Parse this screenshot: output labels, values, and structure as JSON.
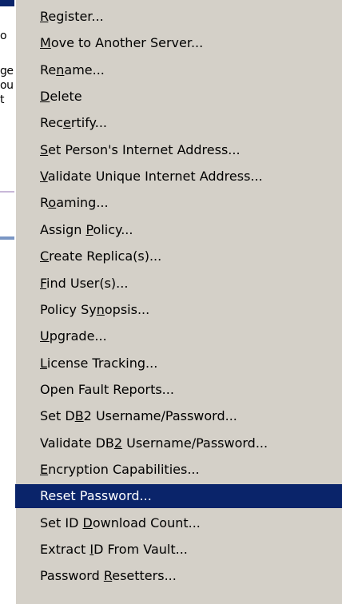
{
  "background_window": {
    "text_lines": [
      "o",
      "ge",
      "ou",
      "t"
    ]
  },
  "menu": {
    "selected_index": 20,
    "colors": {
      "face": "#d4d0c8",
      "highlight": "#0a246a",
      "highlight_text": "#ffffff"
    },
    "items": [
      {
        "label": "Register...",
        "mnemonic_index": 0
      },
      {
        "label": "Move to Another Server...",
        "mnemonic_index": 0
      },
      {
        "label": "Rename...",
        "mnemonic_index": 2
      },
      {
        "label": "Delete",
        "mnemonic_index": 0
      },
      {
        "label": "Recertify...",
        "mnemonic_index": 3
      },
      {
        "label": "Set Person's Internet Address...",
        "mnemonic_index": 0
      },
      {
        "label": "Validate Unique Internet Address...",
        "mnemonic_index": 0
      },
      {
        "label": "Roaming...",
        "mnemonic_index": 1
      },
      {
        "label": "Assign Policy...",
        "mnemonic_index": 7
      },
      {
        "label": "Create Replica(s)...",
        "mnemonic_index": 0
      },
      {
        "label": "Find User(s)...",
        "mnemonic_index": 0
      },
      {
        "label": "Policy Synopsis...",
        "mnemonic_index": 9
      },
      {
        "label": "Upgrade...",
        "mnemonic_index": 0
      },
      {
        "label": "License Tracking...",
        "mnemonic_index": 0
      },
      {
        "label": "Open Fault Reports...",
        "mnemonic_index": -1
      },
      {
        "label": "Set DB2 Username/Password...",
        "mnemonic_index": 5
      },
      {
        "label": "Validate DB2 Username/Password...",
        "mnemonic_index": 11
      },
      {
        "label": "Encryption Capabilities...",
        "mnemonic_index": 0
      },
      {
        "label": "Reset Password...",
        "mnemonic_index": -1
      },
      {
        "label": "Set ID Download Count...",
        "mnemonic_index": 7
      },
      {
        "label": "Extract ID From Vault...",
        "mnemonic_index": 8
      },
      {
        "label": "Password Resetters...",
        "mnemonic_index": 9
      }
    ]
  }
}
